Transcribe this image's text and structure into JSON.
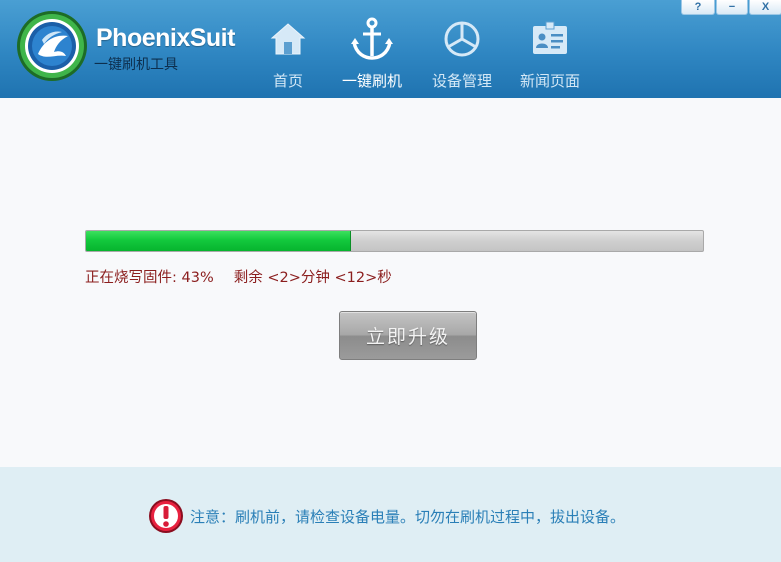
{
  "app": {
    "brand": "PhoenixSuit",
    "subtitle": "一键刷机工具"
  },
  "nav": {
    "items": [
      {
        "label": "首页",
        "icon": "home-icon"
      },
      {
        "label": "一键刷机",
        "icon": "anchor-icon"
      },
      {
        "label": "设备管理",
        "icon": "device-icon"
      },
      {
        "label": "新闻页面",
        "icon": "news-icon"
      }
    ],
    "active": "一键刷机"
  },
  "window_controls": {
    "help": "?",
    "minimize": "−",
    "close": "X"
  },
  "progress": {
    "percent": 43,
    "status_text": "正在烧写固件: 43%",
    "remaining_text": "剩余 <2>分钟 <12>秒"
  },
  "actions": {
    "upgrade_label": "立即升级"
  },
  "notice": {
    "text": "注意：刷机前，请检查设备电量。切勿在刷机过程中，拔出设备。"
  },
  "colors": {
    "header": "#2f86c2",
    "progress_fill": "#13c93d",
    "status_text": "#8b1e1e",
    "notice_text": "#2a7fb7",
    "footer_bg": "#dfeef4"
  }
}
